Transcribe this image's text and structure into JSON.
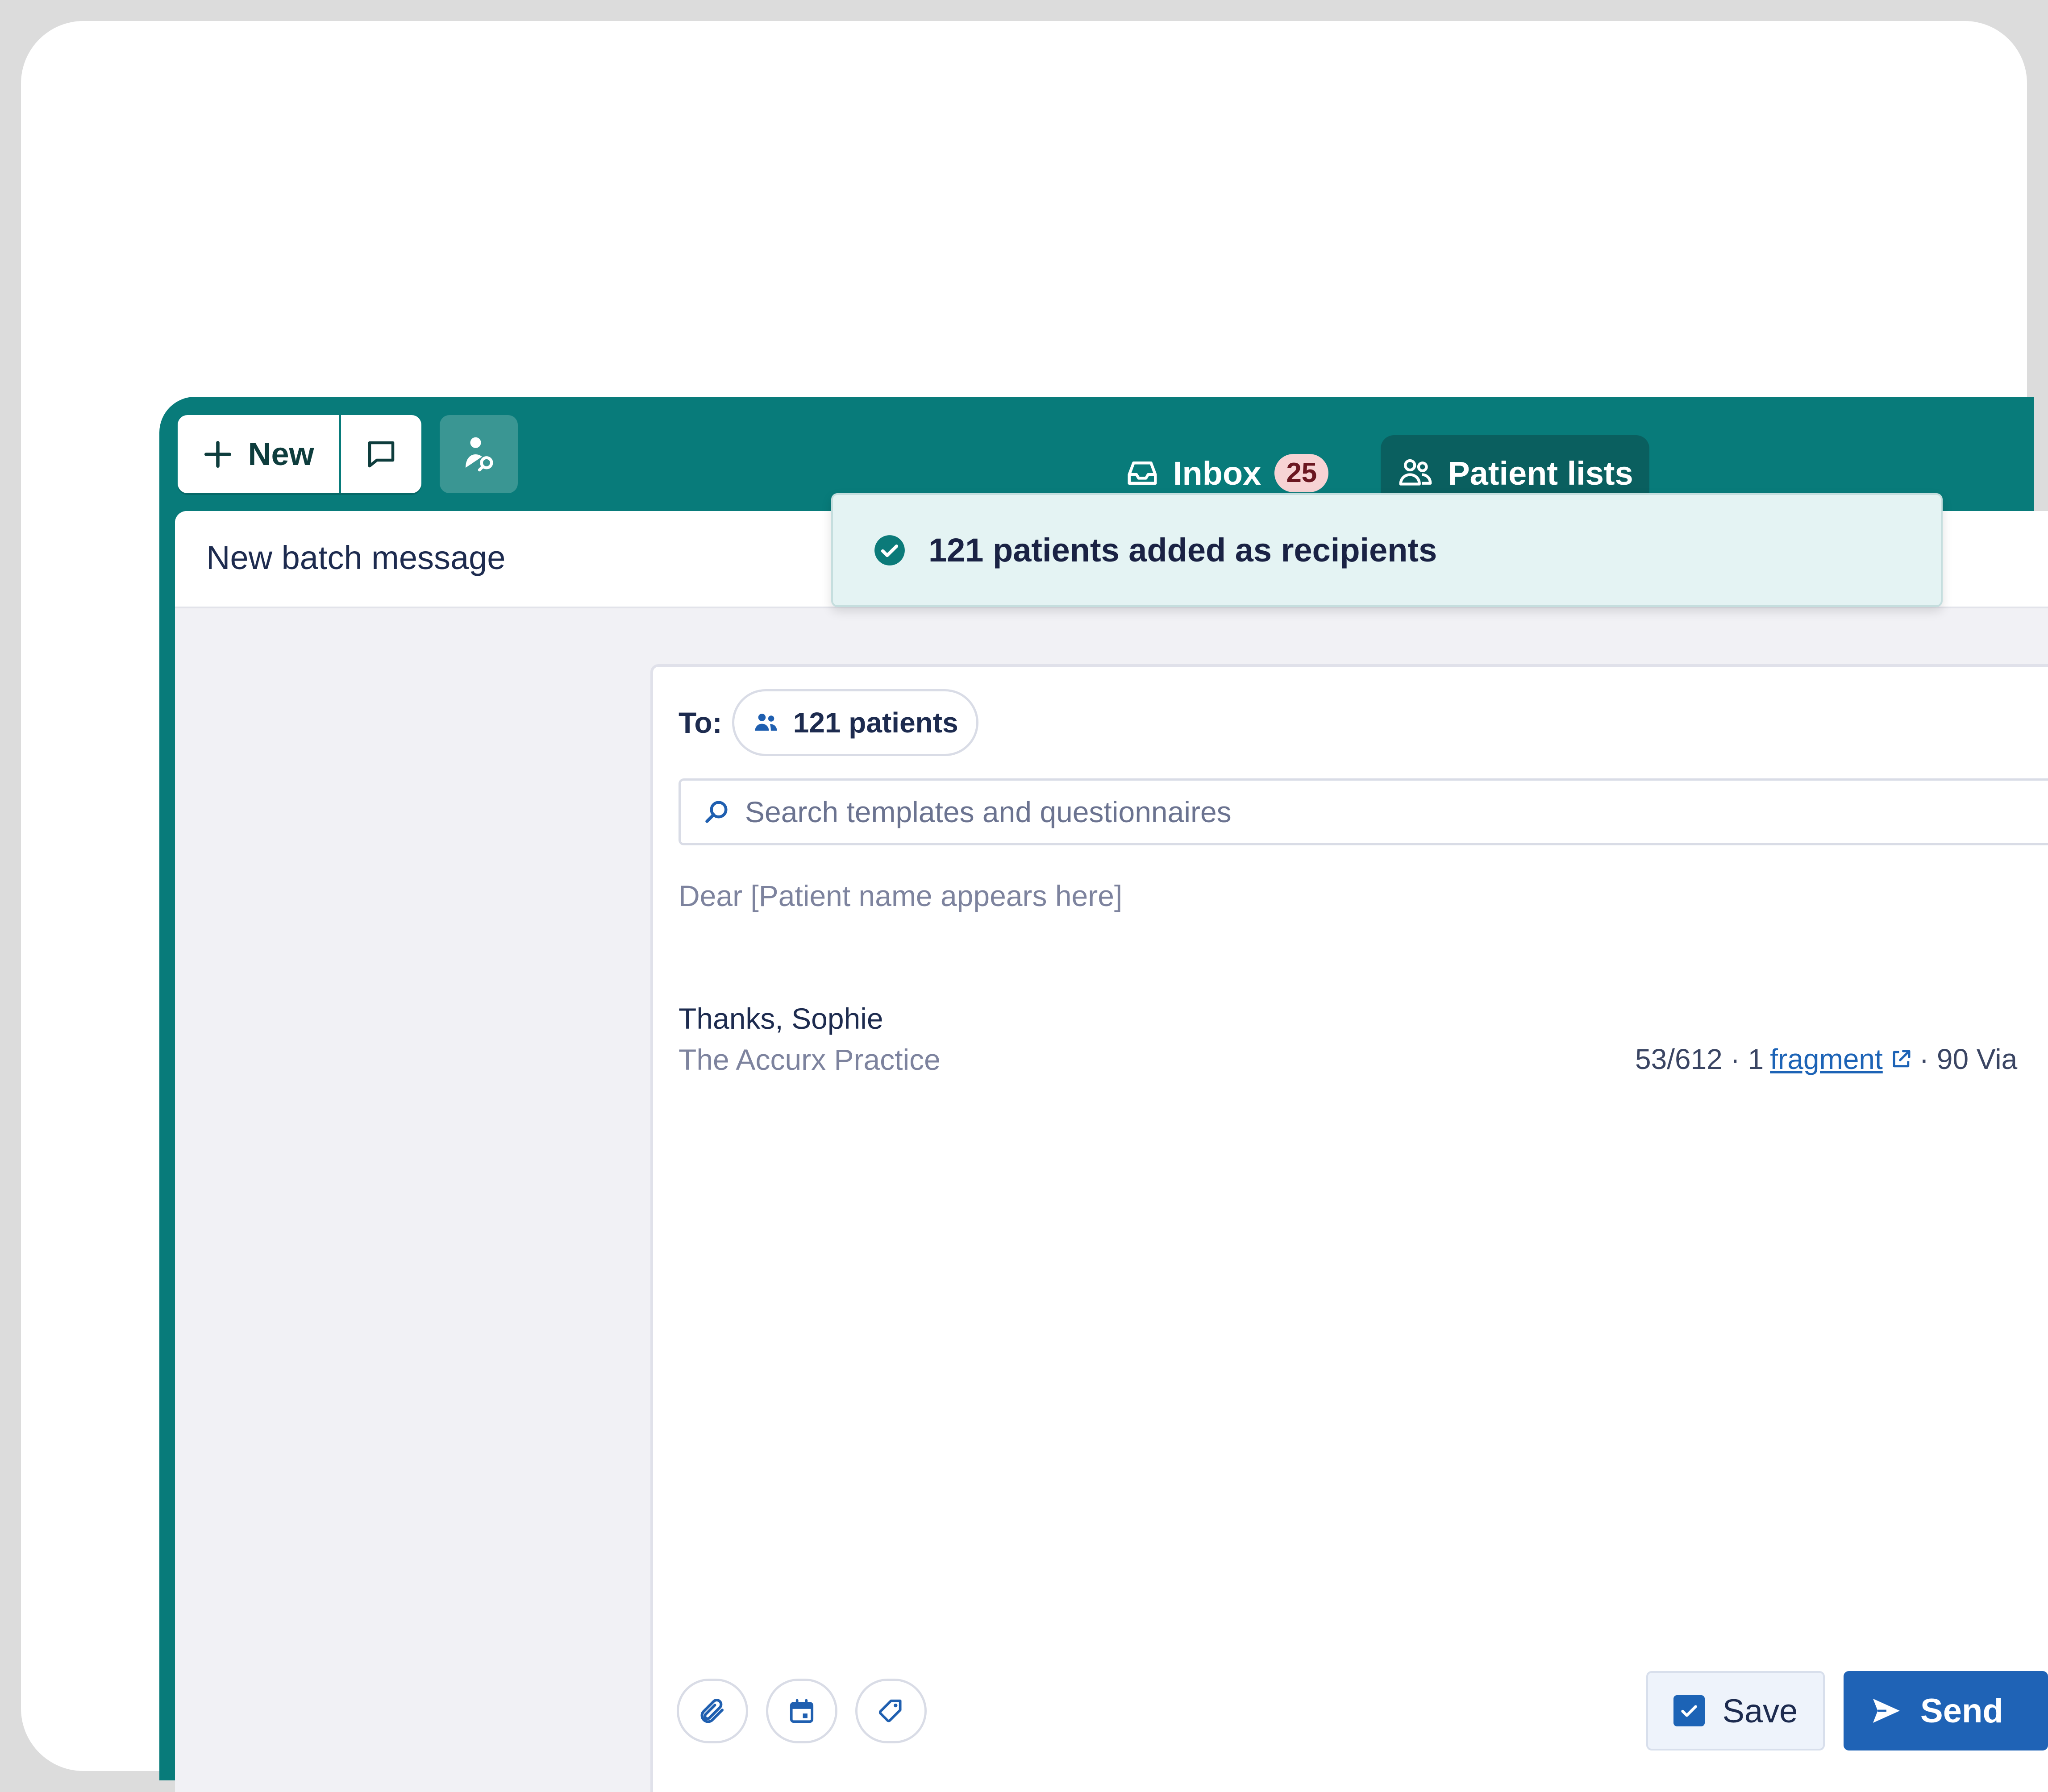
{
  "toolbar": {
    "new_label": "New"
  },
  "nav": {
    "inbox_label": "Inbox",
    "inbox_count": "25",
    "patient_lists_label": "Patient lists"
  },
  "toast": {
    "message": "121 patients added as recipients"
  },
  "page": {
    "title": "New batch message"
  },
  "composer": {
    "to_label": "To:",
    "recipients_label": "121 patients",
    "search_placeholder": "Search templates and questionnaires",
    "greeting": "Dear [Patient name appears here]",
    "signoff": "Thanks, Sophie",
    "practice": "The Accurx Practice",
    "char_count": "53/612 · 1",
    "fragment_link": "fragment",
    "via_text": "· 90 Via",
    "save_label": "Save",
    "send_label": "Send"
  },
  "colors": {
    "brand_teal": "#087b7a",
    "active_tab": "#0a5f5f",
    "primary_blue": "#1f63b6",
    "badge_bg": "#f7d3d4",
    "toast_bg": "#e4f3f3"
  }
}
